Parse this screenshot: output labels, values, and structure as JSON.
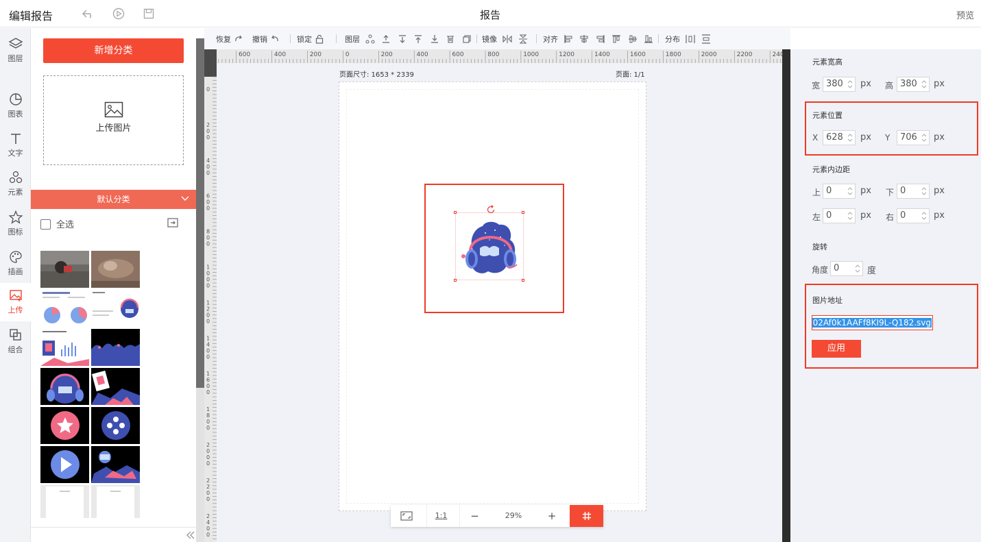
{
  "topbar": {
    "app_title": "编辑报告",
    "doc_title": "报告",
    "preview_label": "预览"
  },
  "iconbar": [
    {
      "label": "图层",
      "icon": "layers-icon"
    },
    {
      "label": "图表",
      "icon": "chart-icon"
    },
    {
      "label": "文字",
      "icon": "text-icon"
    },
    {
      "label": "元素",
      "icon": "shapes-icon"
    },
    {
      "label": "图标",
      "icon": "star-icon"
    },
    {
      "label": "插画",
      "icon": "palette-icon"
    },
    {
      "label": "上传",
      "icon": "upload-image-icon"
    },
    {
      "label": "组合",
      "icon": "group-icon"
    }
  ],
  "left_panel": {
    "add_category_label": "新增分类",
    "upload_label": "上传图片",
    "category_label": "默认分类",
    "select_all_label": "全选"
  },
  "toolbar": {
    "redo": "恢复",
    "undo": "撤销",
    "lock": "锁定",
    "layer": "图层",
    "mirror": "镜像",
    "align": "对齐",
    "distribute": "分布"
  },
  "canvas": {
    "page_size": "页面尺寸: 1653 * 2339",
    "page_num": "页面: 1/1",
    "ruler_h": [
      "600",
      "400",
      "200",
      "0",
      "200",
      "400",
      "600",
      "800",
      "1000",
      "1200",
      "1400",
      "1600",
      "1800",
      "2000",
      "2200",
      "2400"
    ],
    "ruler_v": [
      "0",
      "200",
      "400",
      "600",
      "800",
      "1000",
      "1200",
      "1400",
      "1600",
      "1800",
      "2000",
      "2200",
      "2400"
    ]
  },
  "zoom": {
    "ratio_label": "1:1",
    "minus": "−",
    "value": "29%",
    "plus": "+"
  },
  "properties": {
    "size_title": "元素宽高",
    "width_label": "宽",
    "width": "380",
    "height_label": "高",
    "height": "380",
    "unit": "px",
    "pos_title": "元素位置",
    "x_label": "X",
    "x": "628",
    "y_label": "Y",
    "y": "706",
    "padding_title": "元素内边距",
    "top_label": "上",
    "top": "0",
    "bottom_label": "下",
    "bottom": "0",
    "left_label": "左",
    "left": "0",
    "right_label": "右",
    "right": "0",
    "rotate_title": "旋转",
    "angle_label": "角度",
    "angle": "0",
    "angle_unit": "度",
    "url_title": "图片地址",
    "url_value": "02Af0k1AAFf8KI9L-Q182.svg",
    "apply_label": "应用"
  },
  "colors": {
    "accent": "#f44a34",
    "highlight": "#f03a23",
    "illustration_blue": "#3e4fb0",
    "illustration_pink": "#f06a85"
  }
}
